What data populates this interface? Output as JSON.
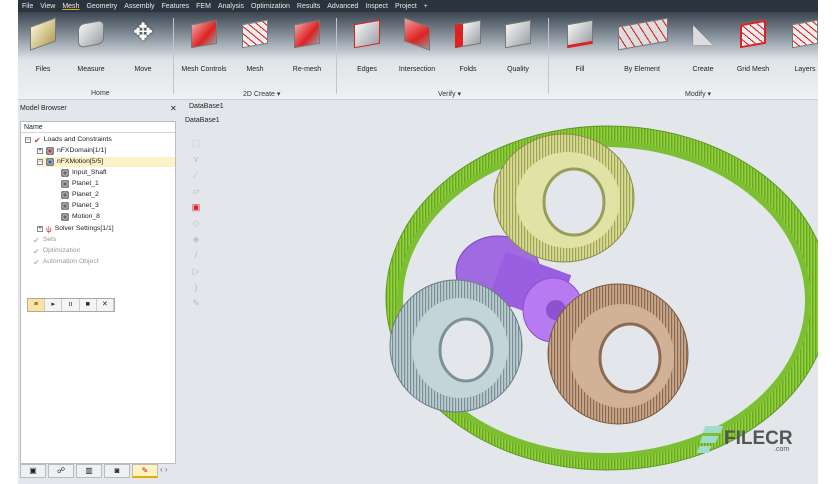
{
  "menu": [
    "File",
    "View",
    "Mesh",
    "Geometry",
    "Assembly",
    "Features",
    "FEM",
    "Analysis",
    "Optimization",
    "Results",
    "Advanced",
    "Inspect",
    "Project",
    "+"
  ],
  "ribbon": {
    "buttons": [
      "Files",
      "Measure",
      "Move",
      "Mesh Controls",
      "Mesh",
      "Re-mesh",
      "Edges",
      "Intersection",
      "Folds",
      "Quality",
      "Fill",
      "By Element",
      "Create",
      "Grid Mesh",
      "Layers"
    ],
    "groups": [
      "Home",
      "2D Create ▾",
      "Verify ▾",
      "Modify ▾"
    ]
  },
  "browser": {
    "title": "Model Browser",
    "close": "✕",
    "column": "Name",
    "nodes": [
      "Loads and Constraints",
      "nFXDomain[1/1]",
      "nFXMotion[5/5]",
      "Input_Shaft",
      "Planet_1",
      "Planet_2",
      "Planet_3",
      "Motion_8",
      "Solver Settings[1/1]",
      "Sets",
      "Optimization",
      "Automation Object"
    ],
    "controls": [
      "≡",
      "▸",
      "ıı",
      "■",
      "✕"
    ],
    "tabs": [
      "▣",
      "☍",
      "▥",
      "◙",
      "✎",
      "‹ ›"
    ]
  },
  "viewport": {
    "tab": "DataBase1",
    "name": "DataBase1"
  },
  "watermark": {
    "brand": "FILECR",
    "suffix": ".com"
  }
}
